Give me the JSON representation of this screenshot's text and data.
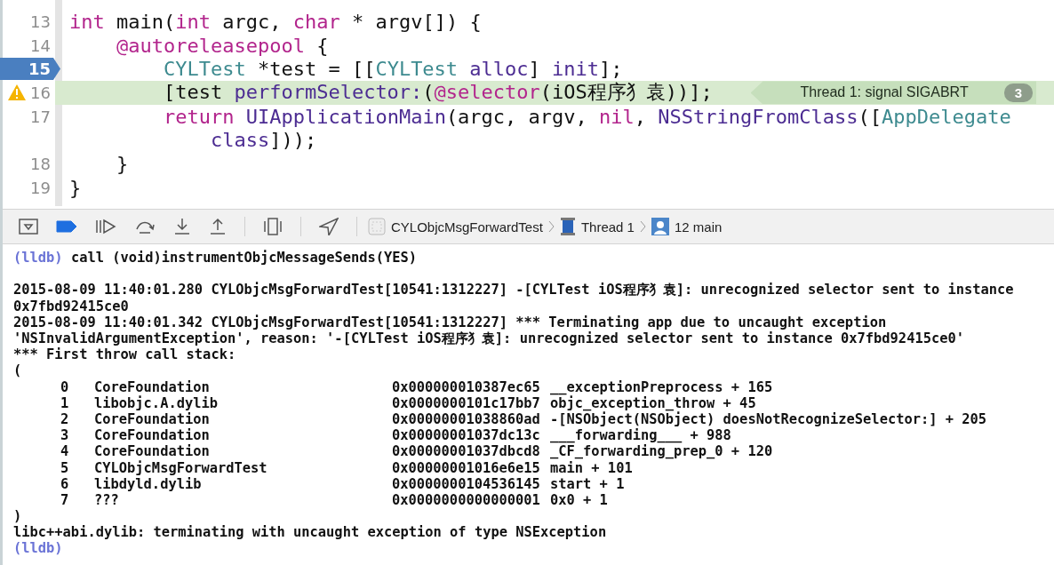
{
  "editor": {
    "lines": [
      {
        "number": "13",
        "breakpoint": false,
        "highlighted": false,
        "warning": false,
        "rows": [
          [
            {
              "text": "int",
              "kind": "keyword"
            },
            {
              "text": " main(",
              "kind": "plain"
            },
            {
              "text": "int",
              "kind": "keyword"
            },
            {
              "text": " argc, ",
              "kind": "plain"
            },
            {
              "text": "char",
              "kind": "keyword"
            },
            {
              "text": " * argv[]) {",
              "kind": "plain"
            }
          ]
        ]
      },
      {
        "number": "14",
        "breakpoint": false,
        "highlighted": false,
        "warning": false,
        "rows": [
          [
            {
              "text": "    ",
              "kind": "plain"
            },
            {
              "text": "@autoreleasepool",
              "kind": "keyword"
            },
            {
              "text": " {",
              "kind": "plain"
            }
          ]
        ]
      },
      {
        "number": "15",
        "breakpoint": true,
        "highlighted": false,
        "warning": false,
        "rows": [
          [
            {
              "text": "        ",
              "kind": "plain"
            },
            {
              "text": "CYLTest",
              "kind": "type"
            },
            {
              "text": " *test = [[",
              "kind": "plain"
            },
            {
              "text": "CYLTest",
              "kind": "type"
            },
            {
              "text": " ",
              "kind": "plain"
            },
            {
              "text": "alloc",
              "kind": "method"
            },
            {
              "text": "] ",
              "kind": "plain"
            },
            {
              "text": "init",
              "kind": "method"
            },
            {
              "text": "];",
              "kind": "plain"
            }
          ]
        ]
      },
      {
        "number": "16",
        "breakpoint": false,
        "highlighted": true,
        "warning": true,
        "rows": [
          [
            {
              "text": "        [test ",
              "kind": "plain"
            },
            {
              "text": "performSelector:",
              "kind": "method"
            },
            {
              "text": "(",
              "kind": "plain"
            },
            {
              "text": "@selector",
              "kind": "keyword"
            },
            {
              "text": "(iOS程序犭袁))];",
              "kind": "plain"
            }
          ]
        ],
        "annotation": {
          "text": "Thread 1: signal SIGABRT",
          "count": "3"
        }
      },
      {
        "number": "17",
        "breakpoint": false,
        "highlighted": false,
        "warning": false,
        "rows": [
          [
            {
              "text": "        ",
              "kind": "plain"
            },
            {
              "text": "return",
              "kind": "keyword"
            },
            {
              "text": " ",
              "kind": "plain"
            },
            {
              "text": "UIApplicationMain",
              "kind": "method"
            },
            {
              "text": "(argc, argv, ",
              "kind": "plain"
            },
            {
              "text": "nil",
              "kind": "keyword"
            },
            {
              "text": ", ",
              "kind": "plain"
            },
            {
              "text": "NSStringFromClass",
              "kind": "method"
            },
            {
              "text": "([",
              "kind": "plain"
            },
            {
              "text": "AppDelegate",
              "kind": "type"
            }
          ],
          [
            {
              "text": "            ",
              "kind": "plain"
            },
            {
              "text": "class",
              "kind": "method"
            },
            {
              "text": "]));",
              "kind": "plain"
            }
          ]
        ]
      },
      {
        "number": "18",
        "breakpoint": false,
        "highlighted": false,
        "warning": false,
        "rows": [
          [
            {
              "text": "    }",
              "kind": "plain"
            }
          ]
        ]
      },
      {
        "number": "19",
        "breakpoint": false,
        "highlighted": false,
        "warning": false,
        "rows": [
          [
            {
              "text": "}",
              "kind": "plain"
            }
          ]
        ]
      }
    ]
  },
  "debug_bar": {
    "breakpoints_active": true,
    "breadcrumbs": [
      {
        "text": "CYLObjcMsgForwardTest",
        "kind": "app"
      },
      {
        "text": "Thread 1",
        "kind": "thread"
      },
      {
        "text": "12 main",
        "kind": "frame"
      }
    ]
  },
  "console": {
    "lines": [
      {
        "kind": "prompt",
        "prompt": "(lldb)",
        "text": "call (void)instrumentObjcMessageSends(YES)"
      },
      {
        "kind": "blank"
      },
      {
        "kind": "text",
        "text": "2015-08-09 11:40:01.280 CYLObjcMsgForwardTest[10541:1312227] -[CYLTest iOS程序犭袁]: unrecognized selector sent to instance"
      },
      {
        "kind": "text",
        "text": "0x7fbd92415ce0"
      },
      {
        "kind": "text",
        "text": "2015-08-09 11:40:01.342 CYLObjcMsgForwardTest[10541:1312227] *** Terminating app due to uncaught exception"
      },
      {
        "kind": "text",
        "text": "'NSInvalidArgumentException', reason: '-[CYLTest iOS程序犭袁]: unrecognized selector sent to instance 0x7fbd92415ce0'"
      },
      {
        "kind": "text",
        "text": "*** First throw call stack:"
      },
      {
        "kind": "text",
        "text": "("
      },
      {
        "kind": "frame",
        "index": "0",
        "library": "CoreFoundation",
        "address": "0x000000010387ec65",
        "symbol": "__exceptionPreprocess + 165"
      },
      {
        "kind": "frame",
        "index": "1",
        "library": "libobjc.A.dylib",
        "address": "0x0000000101c17bb7",
        "symbol": "objc_exception_throw + 45"
      },
      {
        "kind": "frame",
        "index": "2",
        "library": "CoreFoundation",
        "address": "0x00000001038860ad",
        "symbol": "-[NSObject(NSObject) doesNotRecognizeSelector:] + 205"
      },
      {
        "kind": "frame",
        "index": "3",
        "library": "CoreFoundation",
        "address": "0x00000001037dc13c",
        "symbol": "___forwarding___ + 988"
      },
      {
        "kind": "frame",
        "index": "4",
        "library": "CoreFoundation",
        "address": "0x00000001037dbcd8",
        "symbol": "_CF_forwarding_prep_0 + 120"
      },
      {
        "kind": "frame",
        "index": "5",
        "library": "CYLObjcMsgForwardTest",
        "address": "0x00000001016e6e15",
        "symbol": "main + 101"
      },
      {
        "kind": "frame",
        "index": "6",
        "library": "libdyld.dylib",
        "address": "0x0000000104536145",
        "symbol": "start + 1"
      },
      {
        "kind": "frame",
        "index": "7",
        "library": "???",
        "address": "0x0000000000000001",
        "symbol": "0x0 + 1"
      },
      {
        "kind": "text",
        "text": ")"
      },
      {
        "kind": "text",
        "text": "libc++abi.dylib: terminating with uncaught exception of type NSException"
      },
      {
        "kind": "prompt",
        "prompt": "(lldb)"
      }
    ]
  }
}
